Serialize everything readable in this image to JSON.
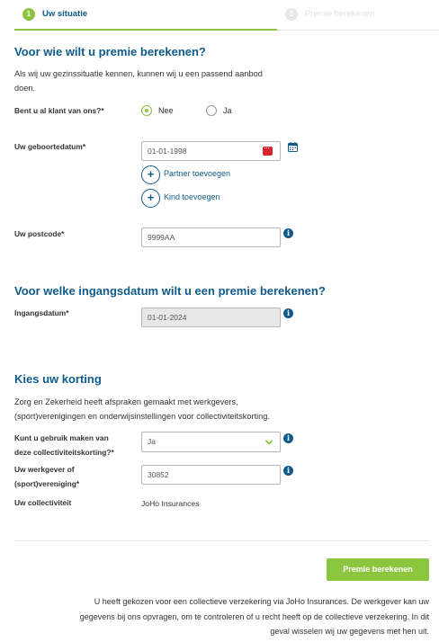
{
  "steps": [
    {
      "number": "1",
      "label": "Uw situatie"
    },
    {
      "number": "2",
      "label": "Premie berekenen"
    }
  ],
  "section_1": {
    "title": "Voor wie wilt u premie berekenen?",
    "intro_line_1": "Als wij uw gezinssituatie kennen, kunnen wij u een passend aanbod",
    "intro_line_2": "doen.",
    "customer_label": "Bent u al klant van ons?*",
    "option_no": "Nee",
    "option_yes": "Ja",
    "selected": "Nee",
    "birthdate_label": "Uw geboortedatum*",
    "birthdate_value": "01-01-1998",
    "add_partner_label": "Partner toevoegen",
    "add_child_label": "Kind toevoegen",
    "postcode_label": "Uw postcode*",
    "postcode_value": "9999AA"
  },
  "section_2": {
    "title": "Voor welke ingangsdatum wilt u een premie berekenen?",
    "start_date_label": "Ingangsdatum*",
    "start_date_value": "01-01-2024"
  },
  "section_3": {
    "title": "Kies uw korting",
    "intro_line_1": "Zorg en Zekerheid heeft afspraken gemaakt met werkgevers,",
    "intro_line_2": "(sport)verenigingen en onderwijsinstellingen voor collectiviteitskorting.",
    "use_discount_label_1": "Kunt u gebruik maken van",
    "use_discount_label_2": "deze collectiviteitskorting?*",
    "use_discount_value": "Ja",
    "employer_label_1": "Uw werkgever of",
    "employer_label_2": "(sport)vereniging*",
    "employer_value": "30852",
    "collectivity_label": "Uw collectiviteit",
    "collectivity_value": "JoHo Insurances"
  },
  "submit_label": "Premie berekenen",
  "disclaimer": {
    "line_1": "U heeft gekozen voor een collectieve verzekering via JoHo Insurances. De werkgever kan uw",
    "line_2": "gegevens bij ons opvragen, om te controleren of u recht heeft op de collectieve verzekering. In dit",
    "line_3": "geval wisselen wij uw gegevens met hen uit."
  },
  "icons": {
    "calendar": "calendar-icon",
    "info": "info-icon",
    "add": "plus-icon",
    "chevron": "chevron-down-icon"
  },
  "colors": {
    "primary": "#0e5a8a",
    "accent": "#8cc63f",
    "calendar_red": "#d9262d"
  }
}
